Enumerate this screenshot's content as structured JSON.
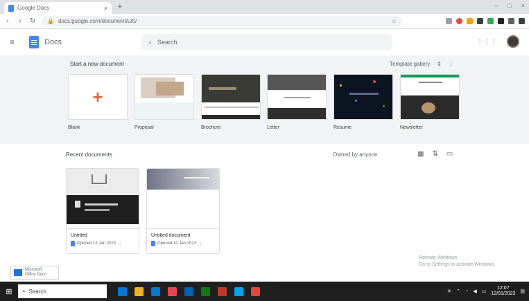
{
  "browser": {
    "tab_title": "Google Docs",
    "tab_close": "×",
    "new_tab": "+",
    "window_controls": [
      "–",
      "□",
      "×"
    ],
    "nav": {
      "back": "‹",
      "forward": "›",
      "reload": "↻"
    },
    "url": "docs.google.com/document/u/0/",
    "extension_colors": [
      "#9aa0a6",
      "#e8453c",
      "#f4a300",
      "#3c4043",
      "#34a853",
      "#202124",
      "#5f6368",
      "#3c4043"
    ]
  },
  "app": {
    "menu": "≡",
    "name": "Docs",
    "search_placeholder": "Search",
    "apps_icon": "⋮⋮⋮"
  },
  "gallery": {
    "title": "Start a new document",
    "controls": {
      "template_gallery": "Template gallery",
      "more": "⋮"
    },
    "templates": [
      {
        "label": "Blank"
      },
      {
        "label": "Proposal"
      },
      {
        "label": "Brochure"
      },
      {
        "label": "Letter"
      },
      {
        "label": "Resume"
      },
      {
        "label": "Newsletter"
      }
    ]
  },
  "recent": {
    "title": "Recent documents",
    "owner_filter": "Owned by anyone",
    "docs": [
      {
        "name": "Untitled",
        "meta": "Opened 12 Jan 2023"
      },
      {
        "name": "Untitled document",
        "meta": "Opened 10 Jan 2023"
      }
    ]
  },
  "watermark": {
    "line1": "Activate Windows",
    "line2": "Go to Settings to activate Windows."
  },
  "notification": {
    "line1": "Microsoft",
    "line2": "Office Docs"
  },
  "taskbar": {
    "search_placeholder": "Search",
    "app_colors": [
      "#0078d4",
      "#f2b01e",
      "#0078d4",
      "#e74856",
      "#0063b1",
      "#107c10",
      "#c0392b",
      "#00a4ef",
      "#e8453c"
    ],
    "clock_time": "12:07",
    "clock_date": "12/01/2023"
  }
}
